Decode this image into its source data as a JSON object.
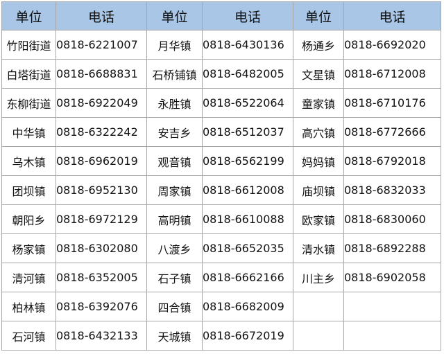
{
  "headers": [
    "单位",
    "电话",
    "单位",
    "电话",
    "单位",
    "电话"
  ],
  "rows": [
    [
      "竹阳街道",
      "0818-6221007",
      "月华镇",
      "0818-6430136",
      "杨通乡",
      "0818-6692020"
    ],
    [
      "白塔街道",
      "0818-6688831",
      "石桥铺镇",
      "0818-6482005",
      "文星镇",
      "0818-6712008"
    ],
    [
      "东柳街道",
      "0818-6922049",
      "永胜镇",
      "0818-6522064",
      "童家镇",
      "0818-6710176"
    ],
    [
      "中华镇",
      "0818-6322242",
      "安吉乡",
      "0818-6512037",
      "高穴镇",
      "0818-6772666"
    ],
    [
      "乌木镇",
      "0818-6962019",
      "观音镇",
      "0818-6562199",
      "妈妈镇",
      "0818-6792018"
    ],
    [
      "团坝镇",
      "0818-6952130",
      "周家镇",
      "0818-6612008",
      "庙坝镇",
      "0818-6832033"
    ],
    [
      "朝阳乡",
      "0818-6972129",
      "高明镇",
      "0818-6610088",
      "欧家镇",
      "0818-6830060"
    ],
    [
      "杨家镇",
      "0818-6302080",
      "八渡乡",
      "0818-6652035",
      "清水镇",
      "0818-6892288"
    ],
    [
      "清河镇",
      "0818-6352005",
      "石子镇",
      "0818-6662166",
      "川主乡",
      "0818-6902058"
    ],
    [
      "柏林镇",
      "0818-6392076",
      "四合镇",
      "0818-6682009",
      "",
      ""
    ],
    [
      "石河镇",
      "0818-6432133",
      "天城镇",
      "0818-6672019",
      "",
      ""
    ]
  ]
}
